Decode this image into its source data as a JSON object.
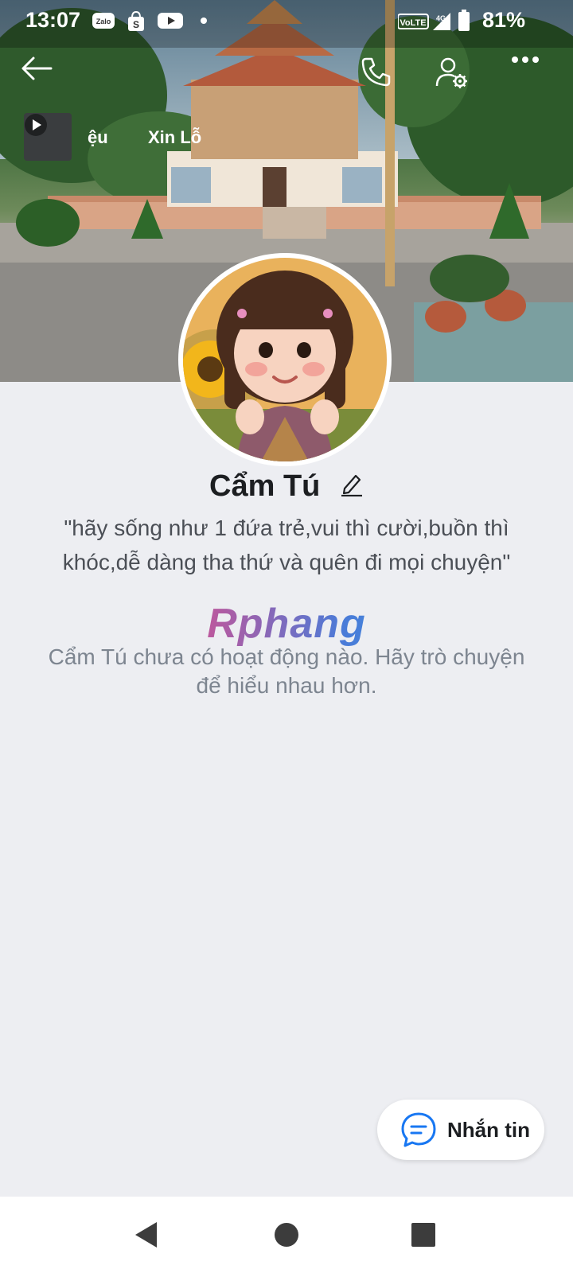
{
  "statusbar": {
    "time": "13:07",
    "battery": "81%",
    "app_icons": [
      "zalo-icon",
      "shopee-icon",
      "youtube-icon",
      "dot"
    ],
    "network": "VoLTE 4G",
    "zalo_label": "Zalo"
  },
  "cover": {
    "music_title_partial": "ệu",
    "music_title_2": "Xin Lỗ"
  },
  "profile": {
    "name": "Cẩm Tú",
    "bio": "\"hãy sống như 1 đứa trẻ,vui thì cười,buồn thì khóc,dễ dàng tha thứ và quên đi mọi chuyện\"",
    "watermark": "Rphang",
    "empty_message": "Cẩm Tú chưa có hoạt động nào. Hãy trò chuyện để hiểu nhau hơn."
  },
  "actions": {
    "message_button": "Nhắn tin"
  },
  "colors": {
    "accent": "#1877f2",
    "background": "#edeef2",
    "text_primary": "#1c1e21",
    "text_secondary": "#4b4f56",
    "text_muted": "#7d8590"
  }
}
